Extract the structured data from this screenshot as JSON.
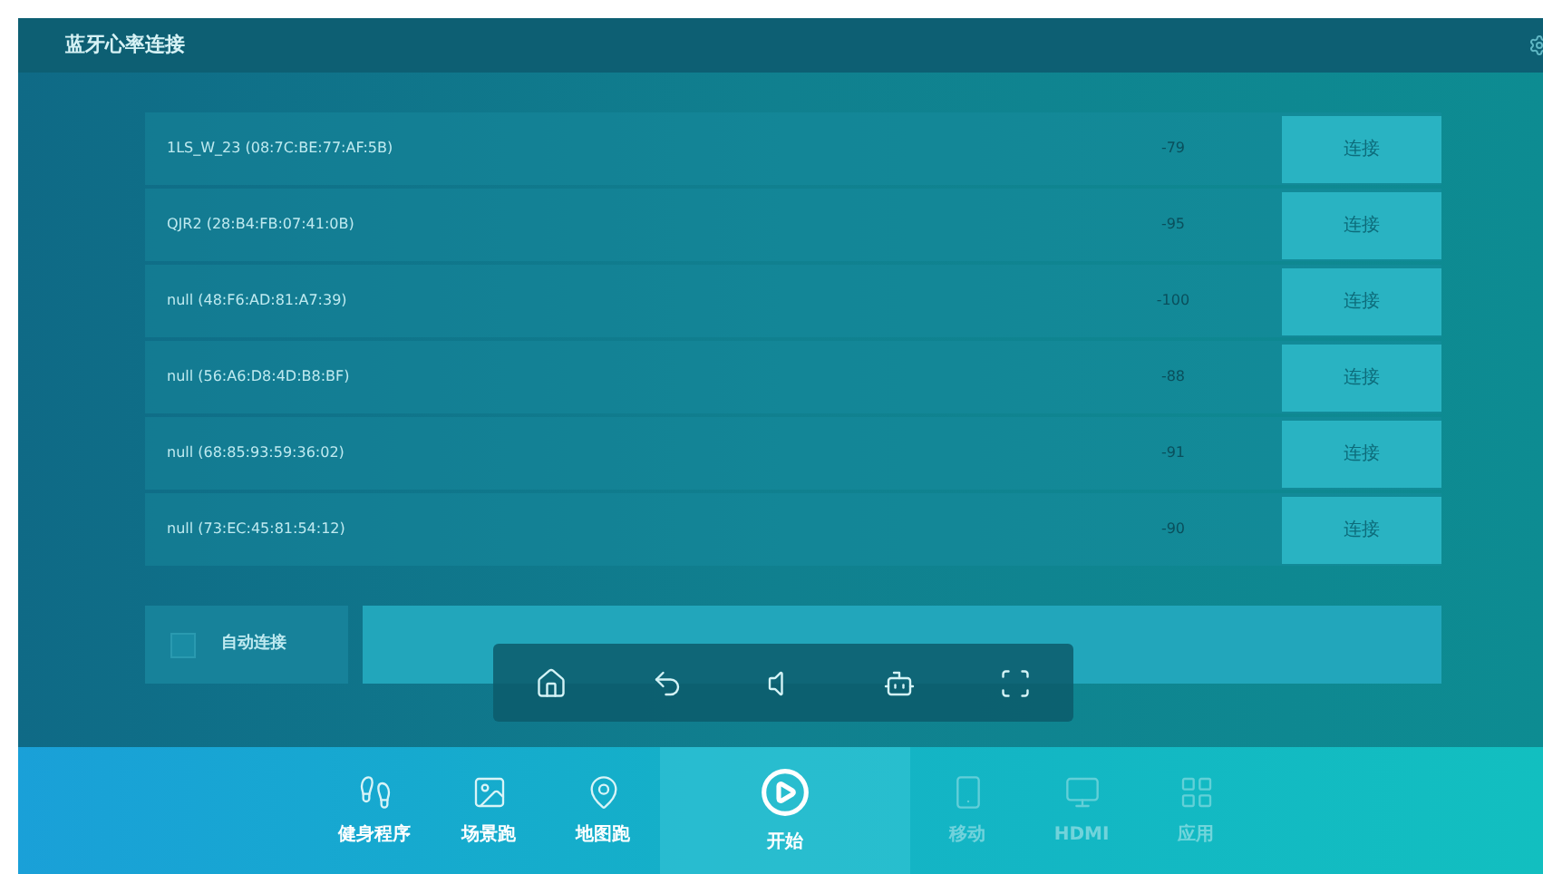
{
  "window": {
    "title": "蓝牙心率连接"
  },
  "devices": [
    {
      "name": "1LS_W_23 (08:7C:BE:77:AF:5B)",
      "rssi": "-79",
      "action": "连接"
    },
    {
      "name": "QJR2 (28:B4:FB:07:41:0B)",
      "rssi": "-95",
      "action": "连接"
    },
    {
      "name": "null (48:F6:AD:81:A7:39)",
      "rssi": "-100",
      "action": "连接"
    },
    {
      "name": "null (56:A6:D8:4D:B8:BF)",
      "rssi": "-88",
      "action": "连接"
    },
    {
      "name": "null (68:85:93:59:36:02)",
      "rssi": "-91",
      "action": "连接"
    },
    {
      "name": "null (73:EC:45:81:54:12)",
      "rssi": "-90",
      "action": "连接"
    }
  ],
  "auto_connect": {
    "label": "自动连接",
    "checked": false
  },
  "dock": [
    {
      "kind": "program",
      "label": "健身程序",
      "selected": false,
      "disabled": false
    },
    {
      "kind": "scene",
      "label": "场景跑",
      "selected": false,
      "disabled": false
    },
    {
      "kind": "map",
      "label": "地图跑",
      "selected": false,
      "disabled": false
    },
    {
      "kind": "start",
      "label": "开始",
      "selected": true,
      "disabled": false
    },
    {
      "kind": "mobile",
      "label": "移动",
      "selected": false,
      "disabled": true
    },
    {
      "kind": "hdmi",
      "label": "HDMI",
      "selected": false,
      "disabled": true
    },
    {
      "kind": "apps",
      "label": "应用",
      "selected": false,
      "disabled": true
    }
  ]
}
